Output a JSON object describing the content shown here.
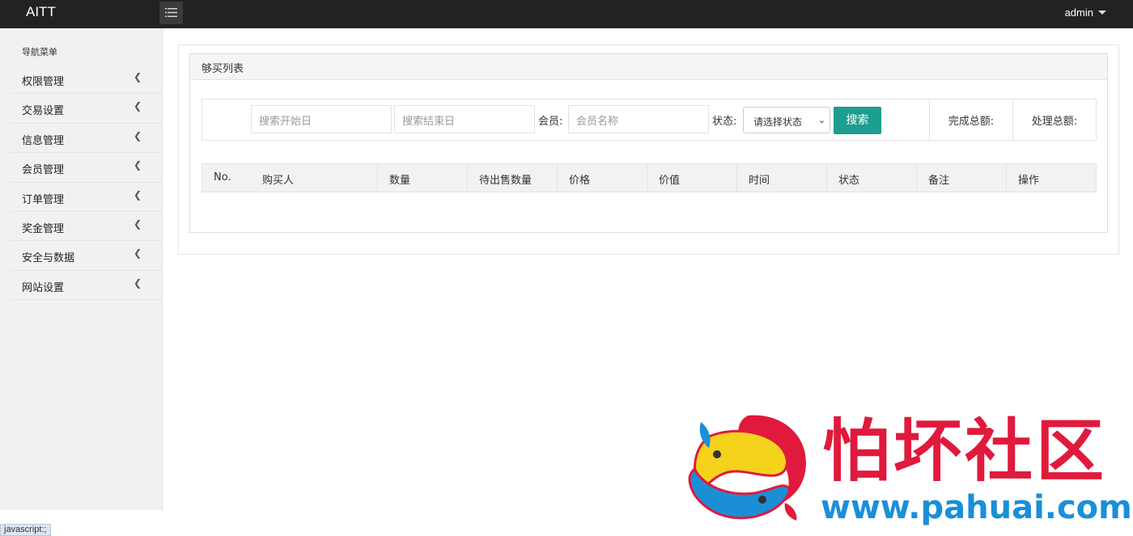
{
  "app": {
    "title": "AITT",
    "user": "admin"
  },
  "sidebar": {
    "heading": "导航菜单",
    "items": [
      {
        "label": "权限管理"
      },
      {
        "label": "交易设置"
      },
      {
        "label": "信息管理"
      },
      {
        "label": "会员管理"
      },
      {
        "label": "订单管理"
      },
      {
        "label": "奖金管理"
      },
      {
        "label": "安全与数据"
      },
      {
        "label": "网站设置"
      }
    ]
  },
  "panel": {
    "title": "够买列表"
  },
  "search": {
    "start_placeholder": "搜索开始日",
    "end_placeholder": "搜索结束日",
    "member_label": "会员:",
    "member_placeholder": "会员名称",
    "status_label": "状态:",
    "status_selected": "请选择状态",
    "button_label": "搜索",
    "complete_total_label": "完成总额:",
    "process_total_label": "处理总额:"
  },
  "table": {
    "columns": [
      "No.",
      "购买人",
      "数量",
      "待出售数量",
      "价格",
      "价值",
      "时间",
      "状态",
      "备注",
      "操作"
    ]
  },
  "watermark": {
    "title": "怕坏社区",
    "url": "www.pahuai.com"
  },
  "statusbar": {
    "text": "javascript:;"
  },
  "colors": {
    "topbar": "#222222",
    "accent": "#1e9e8f",
    "watermark_red": "#e01a3c",
    "watermark_blue": "#1a8fd8"
  }
}
